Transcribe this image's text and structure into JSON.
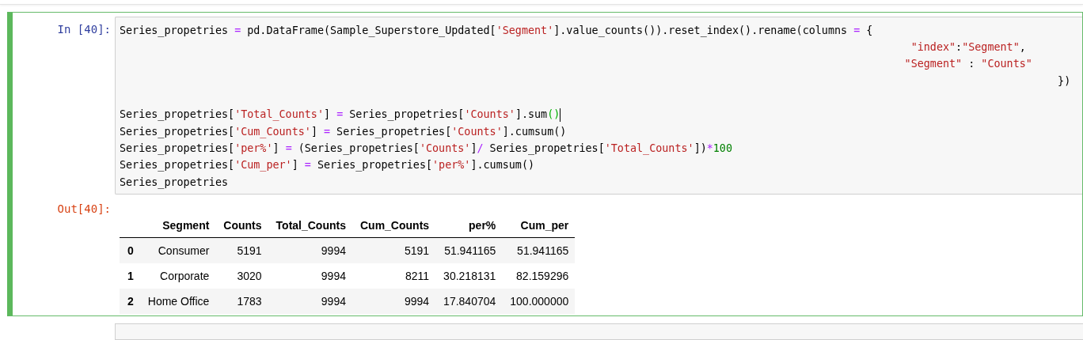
{
  "cell": {
    "prompt_in": "In [40]:",
    "prompt_out": "Out[40]:",
    "code_lines": [
      {
        "tokens": [
          {
            "kind": "name",
            "text": "Series_propetries "
          },
          {
            "kind": "op",
            "text": "="
          },
          {
            "kind": "name",
            "text": " pd.DataFrame(Sample_Superstore_Updated["
          },
          {
            "kind": "str",
            "text": "'Segment'"
          },
          {
            "kind": "name",
            "text": "].value_counts()).reset_index().rename(columns "
          },
          {
            "kind": "op",
            "text": "="
          },
          {
            "kind": "name",
            "text": " {"
          }
        ]
      },
      {
        "tokens": [
          {
            "kind": "str",
            "text": "                                                                                                                            \"index\""
          },
          {
            "kind": "name",
            "text": ":"
          },
          {
            "kind": "str",
            "text": "\"Segment\""
          },
          {
            "kind": "name",
            "text": ","
          }
        ]
      },
      {
        "tokens": [
          {
            "kind": "str",
            "text": "                                                                                                                           \"Segment\""
          },
          {
            "kind": "name",
            "text": " : "
          },
          {
            "kind": "str",
            "text": "\"Counts\""
          }
        ]
      },
      {
        "tokens": [
          {
            "kind": "name",
            "text": "                                                                                                                                                   })"
          }
        ]
      },
      {
        "gap_before": true,
        "cursor_after": true,
        "tokens": [
          {
            "kind": "name",
            "text": "Series_propetries["
          },
          {
            "kind": "str",
            "text": "'Total_Counts'"
          },
          {
            "kind": "name",
            "text": "] "
          },
          {
            "kind": "op",
            "text": "="
          },
          {
            "kind": "name",
            "text": " Series_propetries["
          },
          {
            "kind": "str",
            "text": "'Counts'"
          },
          {
            "kind": "name",
            "text": "].sum"
          },
          {
            "kind": "match",
            "text": "()"
          }
        ]
      },
      {
        "tokens": [
          {
            "kind": "name",
            "text": "Series_propetries["
          },
          {
            "kind": "str",
            "text": "'Cum_Counts'"
          },
          {
            "kind": "name",
            "text": "] "
          },
          {
            "kind": "op",
            "text": "="
          },
          {
            "kind": "name",
            "text": " Series_propetries["
          },
          {
            "kind": "str",
            "text": "'Counts'"
          },
          {
            "kind": "name",
            "text": "].cumsum()"
          }
        ]
      },
      {
        "tokens": [
          {
            "kind": "name",
            "text": "Series_propetries["
          },
          {
            "kind": "str",
            "text": "'per%'"
          },
          {
            "kind": "name",
            "text": "] "
          },
          {
            "kind": "op",
            "text": "="
          },
          {
            "kind": "name",
            "text": " (Series_propetries["
          },
          {
            "kind": "str",
            "text": "'Counts'"
          },
          {
            "kind": "name",
            "text": "]"
          },
          {
            "kind": "op",
            "text": "/"
          },
          {
            "kind": "name",
            "text": " Series_propetries["
          },
          {
            "kind": "str",
            "text": "'Total_Counts'"
          },
          {
            "kind": "name",
            "text": "])"
          },
          {
            "kind": "op",
            "text": "*"
          },
          {
            "kind": "num",
            "text": "100"
          }
        ]
      },
      {
        "tokens": [
          {
            "kind": "name",
            "text": "Series_propetries["
          },
          {
            "kind": "str",
            "text": "'Cum_per'"
          },
          {
            "kind": "name",
            "text": "] "
          },
          {
            "kind": "op",
            "text": "="
          },
          {
            "kind": "name",
            "text": " Series_propetries["
          },
          {
            "kind": "str",
            "text": "'per%'"
          },
          {
            "kind": "name",
            "text": "].cumsum()"
          }
        ]
      },
      {
        "tokens": [
          {
            "kind": "name",
            "text": "Series_propetries"
          }
        ]
      }
    ],
    "table": {
      "columns": [
        "Segment",
        "Counts",
        "Total_Counts",
        "Cum_Counts",
        "per%",
        "Cum_per"
      ],
      "rows": [
        {
          "index": "0",
          "cells": [
            "Consumer",
            "5191",
            "9994",
            "5191",
            "51.941165",
            "51.941165"
          ]
        },
        {
          "index": "1",
          "cells": [
            "Corporate",
            "3020",
            "9994",
            "8211",
            "30.218131",
            "82.159296"
          ]
        },
        {
          "index": "2",
          "cells": [
            "Home Office",
            "1783",
            "9994",
            "9994",
            "17.840704",
            "100.000000"
          ]
        }
      ]
    }
  }
}
